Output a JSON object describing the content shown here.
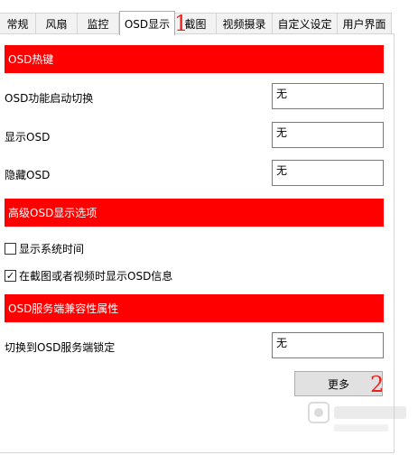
{
  "tabs": [
    {
      "label": "常规",
      "width": 40
    },
    {
      "label": "风扇",
      "width": 46
    },
    {
      "label": "监控",
      "width": 46
    },
    {
      "label": "OSD显示",
      "width": 62,
      "active": true
    },
    {
      "label": "截图",
      "width": 46
    },
    {
      "label": "视频摄录",
      "width": 62
    },
    {
      "label": "自定义设定",
      "width": 72
    },
    {
      "label": "用户界面",
      "width": 60
    }
  ],
  "sections": {
    "hotkeys": {
      "title": "OSD热键"
    },
    "advanced": {
      "title": "高级OSD显示选项"
    },
    "compat": {
      "title": "OSD服务端兼容性属性"
    }
  },
  "hotkeys": [
    {
      "label": "OSD功能启动切换",
      "value": "无"
    },
    {
      "label": "显示OSD",
      "value": "无"
    },
    {
      "label": "隐藏OSD",
      "value": "无"
    }
  ],
  "options": [
    {
      "label": "显示系统时间",
      "checked": false
    },
    {
      "label": "在截图或者视频时显示OSD信息",
      "checked": true
    }
  ],
  "compat_row": {
    "label": "切换到OSD服务端锁定",
    "value": "无"
  },
  "more_button": {
    "label": "更多"
  },
  "annotations": {
    "one": "1",
    "two": "2"
  },
  "colors": {
    "section_header": "#ff0000",
    "annotation": "#e8231e"
  }
}
